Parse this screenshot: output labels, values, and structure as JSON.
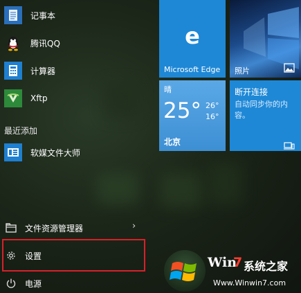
{
  "apps": [
    {
      "label": "记事本",
      "icon": "notepad-icon"
    },
    {
      "label": "腾讯QQ",
      "icon": "qq-penguin-icon"
    },
    {
      "label": "计算器",
      "icon": "calculator-icon"
    },
    {
      "label": "Xftp",
      "icon": "xftp-icon"
    }
  ],
  "recent_section": "最近添加",
  "recent_apps": [
    {
      "label": "软媒文件大师",
      "icon": "file-master-icon"
    }
  ],
  "system_items": [
    {
      "label": "文件资源管理器",
      "icon": "file-explorer-icon"
    },
    {
      "label": "设置",
      "icon": "gear-icon"
    },
    {
      "label": "电源",
      "icon": "power-icon"
    }
  ],
  "tiles": {
    "edge": {
      "label": "Microsoft Edge",
      "color": "#1e88d6"
    },
    "photos": {
      "label": "照片"
    },
    "weather": {
      "condition": "晴",
      "temp": "25°",
      "high": "26°",
      "low": "16°",
      "city": "北京",
      "color": "#3d8fd4"
    },
    "sync": {
      "title": "断开连接",
      "desc_line1": "自动同步你的内",
      "desc_line2": "容。",
      "color": "#1e88d6"
    }
  },
  "watermark": {
    "brand_win": "Win",
    "brand_7": "7",
    "brand_cn": "系统之家",
    "url": "Www.Winwin7.com"
  },
  "colors": {
    "highlight": "#d8202a",
    "tile_blue": "#1e88d6"
  }
}
